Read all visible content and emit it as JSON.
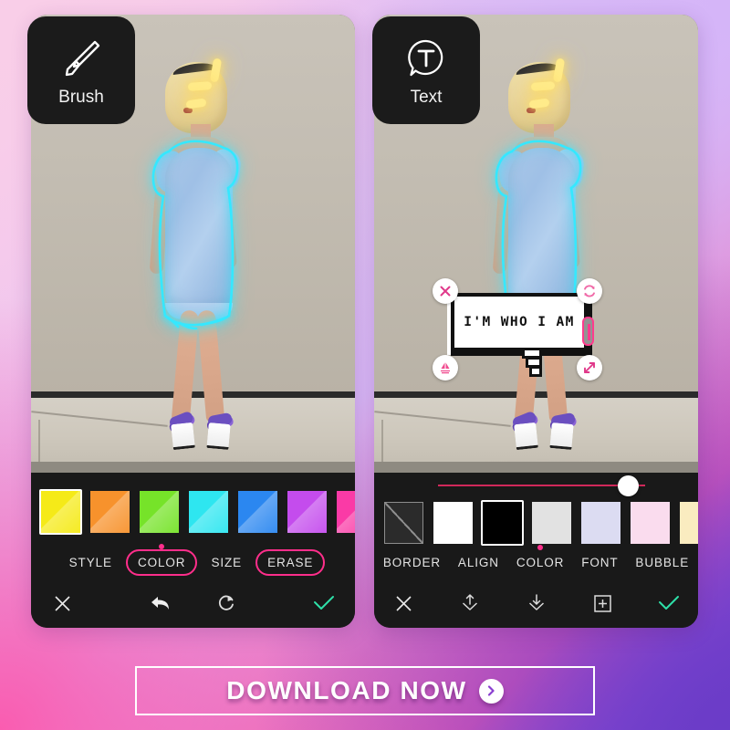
{
  "background": {
    "corner_top_left": "#f9cee9",
    "corner_top_right": "#d7b8f7",
    "corner_bottom_left": "#fa5cb0",
    "corner_bottom_right": "#6b3cc8"
  },
  "badges": {
    "brush": {
      "label": "Brush",
      "icon": "paintbrush-icon"
    },
    "text": {
      "label": "Text",
      "icon": "text-bubble-icon"
    }
  },
  "left_panel": {
    "name": "brush-editor",
    "effect": "cyan neon outline traced on dress",
    "sparkle_color": "#ffe169",
    "neon_color": "#35e8ff",
    "palette": {
      "selected_index": 0,
      "swatches": [
        {
          "name": "yellow",
          "hex": "#f5ea18"
        },
        {
          "name": "orange",
          "hex": "#f7922c"
        },
        {
          "name": "green",
          "hex": "#76e329"
        },
        {
          "name": "cyan",
          "hex": "#2ee6f0"
        },
        {
          "name": "blue",
          "hex": "#2b87f0"
        },
        {
          "name": "purple",
          "hex": "#c44ced"
        },
        {
          "name": "pink",
          "hex": "#fa3aa6"
        },
        {
          "name": "dark",
          "hex": "#3a3a3a"
        }
      ]
    },
    "tools": [
      {
        "label": "STYLE",
        "ringed": false,
        "dot": false
      },
      {
        "label": "COLOR",
        "ringed": true,
        "dot": true
      },
      {
        "label": "SIZE",
        "ringed": false,
        "dot": false
      },
      {
        "label": "ERASE",
        "ringed": true,
        "dot": false
      }
    ],
    "actions": [
      {
        "name": "close-button",
        "icon": "close-x-icon"
      },
      {
        "name": "undo-button",
        "icon": "undo-arrow-icon"
      },
      {
        "name": "reset-button",
        "icon": "reset-circle-icon"
      },
      {
        "name": "confirm-button",
        "icon": "check-icon",
        "color": "#2ee0a8"
      }
    ],
    "highlight_color": "#ff2e8b"
  },
  "right_panel": {
    "name": "text-editor",
    "bubble": {
      "text": "I'M WHO I AM",
      "style": "pixel speech bubble",
      "handles": [
        {
          "name": "delete-handle",
          "icon": "close-x-icon",
          "color": "#e0398a"
        },
        {
          "name": "rotate-handle",
          "icon": "rotate-icon",
          "color": "#f06aa8"
        },
        {
          "name": "layer-handle",
          "icon": "layers-icon",
          "color": "#f04a8e"
        },
        {
          "name": "resize-handle",
          "icon": "resize-arrows-icon",
          "color": "#e0398a"
        }
      ],
      "caret": {
        "name": "text-caret",
        "color": "#ff3b8d"
      }
    },
    "slider": {
      "name": "opacity-slider",
      "value_pct": 92,
      "track_color": "#d1285a"
    },
    "palette": {
      "selected_index": 2,
      "swatches": [
        {
          "name": "transparent",
          "hex": "none"
        },
        {
          "name": "white",
          "hex": "#ffffff"
        },
        {
          "name": "black",
          "hex": "#000000"
        },
        {
          "name": "light-gray",
          "hex": "#e2e2e2"
        },
        {
          "name": "lavender",
          "hex": "#dcdcf2"
        },
        {
          "name": "pale-pink",
          "hex": "#fadcee"
        },
        {
          "name": "cream",
          "hex": "#faecc0"
        },
        {
          "name": "mint",
          "hex": "#e2f5dc"
        }
      ]
    },
    "tools": [
      {
        "label": "BORDER",
        "dot": false
      },
      {
        "label": "ALIGN",
        "dot": false
      },
      {
        "label": "COLOR",
        "dot": true
      },
      {
        "label": "FONT",
        "dot": false
      },
      {
        "label": "BUBBLE",
        "dot": false
      }
    ],
    "actions": [
      {
        "name": "close-button",
        "icon": "close-x-icon"
      },
      {
        "name": "bring-forward-button",
        "icon": "arrow-up-layer-icon"
      },
      {
        "name": "send-backward-button",
        "icon": "arrow-down-layer-icon"
      },
      {
        "name": "add-text-button",
        "icon": "plus-box-icon"
      },
      {
        "name": "confirm-button",
        "icon": "check-icon",
        "color": "#2ee0a8"
      }
    ]
  },
  "cta": {
    "label": "DOWNLOAD NOW",
    "icon": "chevron-right-circle-icon"
  }
}
